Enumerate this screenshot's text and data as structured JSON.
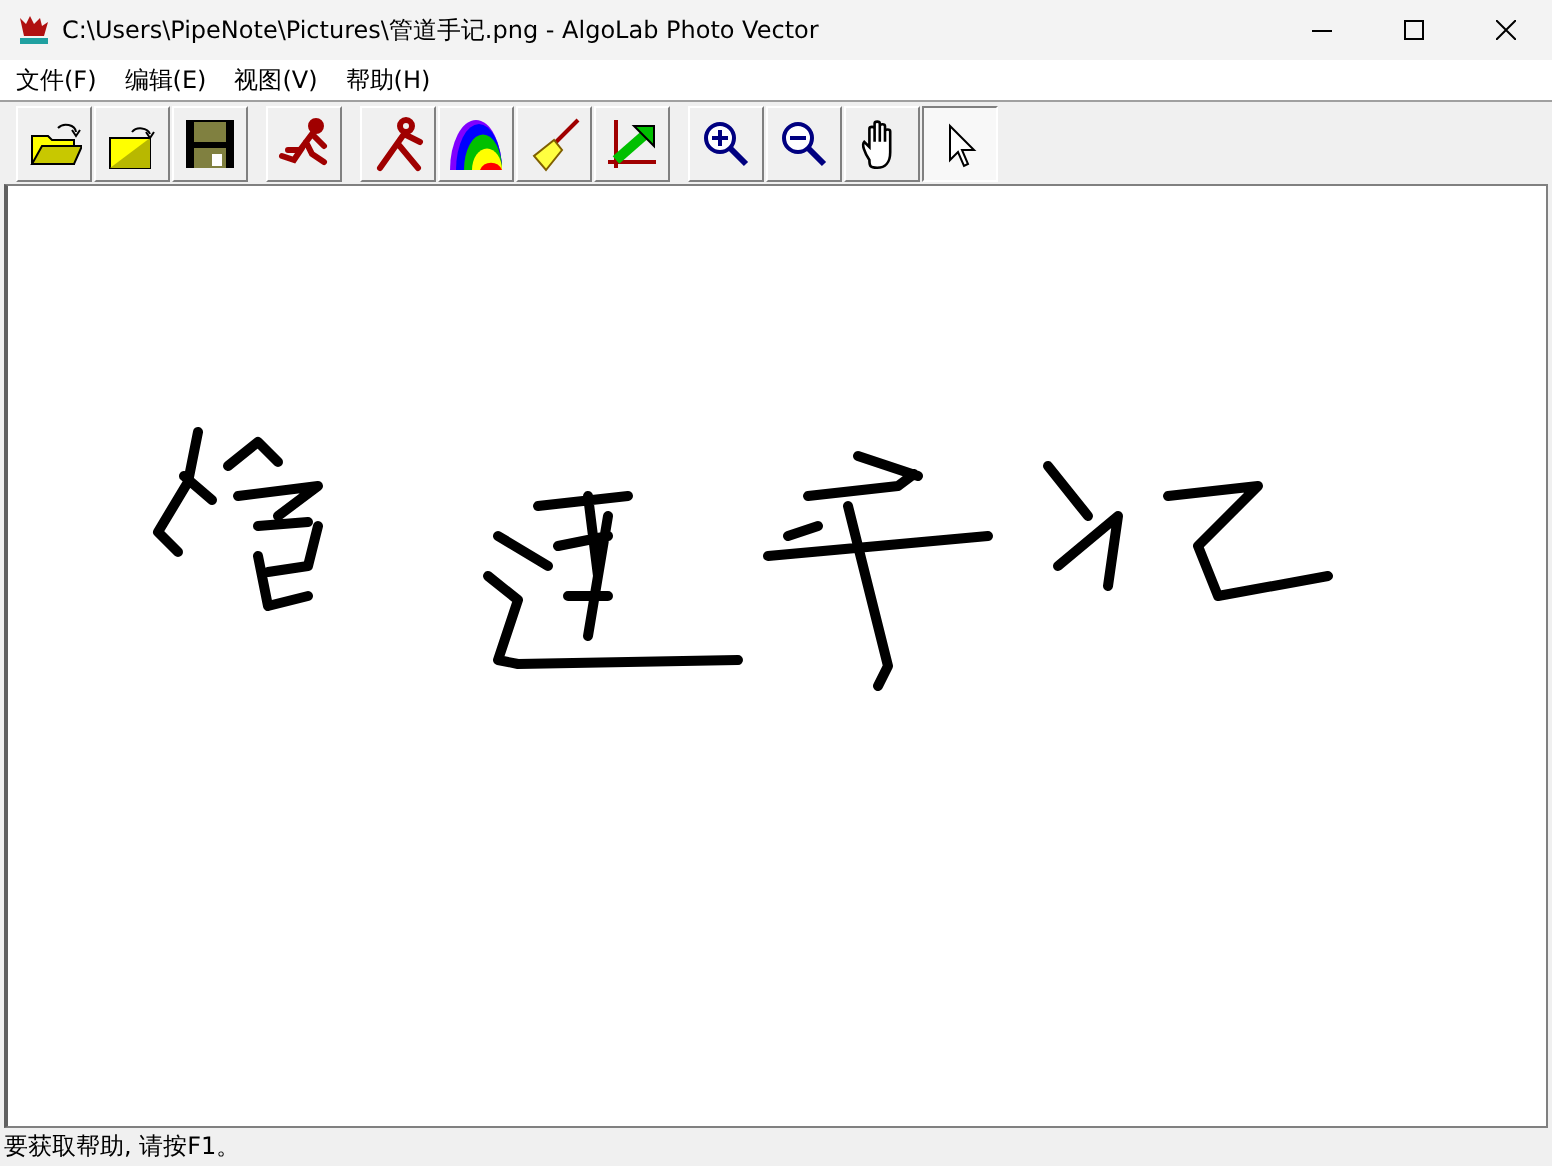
{
  "window": {
    "title": "C:\\Users\\PipeNote\\Pictures\\管道手记.png - AlgoLab Photo Vector"
  },
  "menu": [
    {
      "label": "文件(F)"
    },
    {
      "label": "编辑(E)"
    },
    {
      "label": "视图(V)"
    },
    {
      "label": "帮助(H)"
    }
  ],
  "toolbar": {
    "groups": [
      [
        {
          "kind": "open-folder",
          "selected": false
        },
        {
          "kind": "open-image",
          "selected": false
        },
        {
          "kind": "save",
          "selected": false
        }
      ],
      [
        {
          "kind": "runner",
          "selected": false
        }
      ],
      [
        {
          "kind": "figure",
          "selected": false
        },
        {
          "kind": "rainbow",
          "selected": false
        },
        {
          "kind": "broom",
          "selected": false
        },
        {
          "kind": "chart-arrow",
          "selected": false
        }
      ],
      [
        {
          "kind": "zoom-in",
          "selected": false
        },
        {
          "kind": "zoom-out",
          "selected": false
        },
        {
          "kind": "hand",
          "selected": false
        },
        {
          "kind": "pointer",
          "selected": true
        }
      ]
    ]
  },
  "status_bar": {
    "text": "要获取帮助, 请按F1。"
  }
}
